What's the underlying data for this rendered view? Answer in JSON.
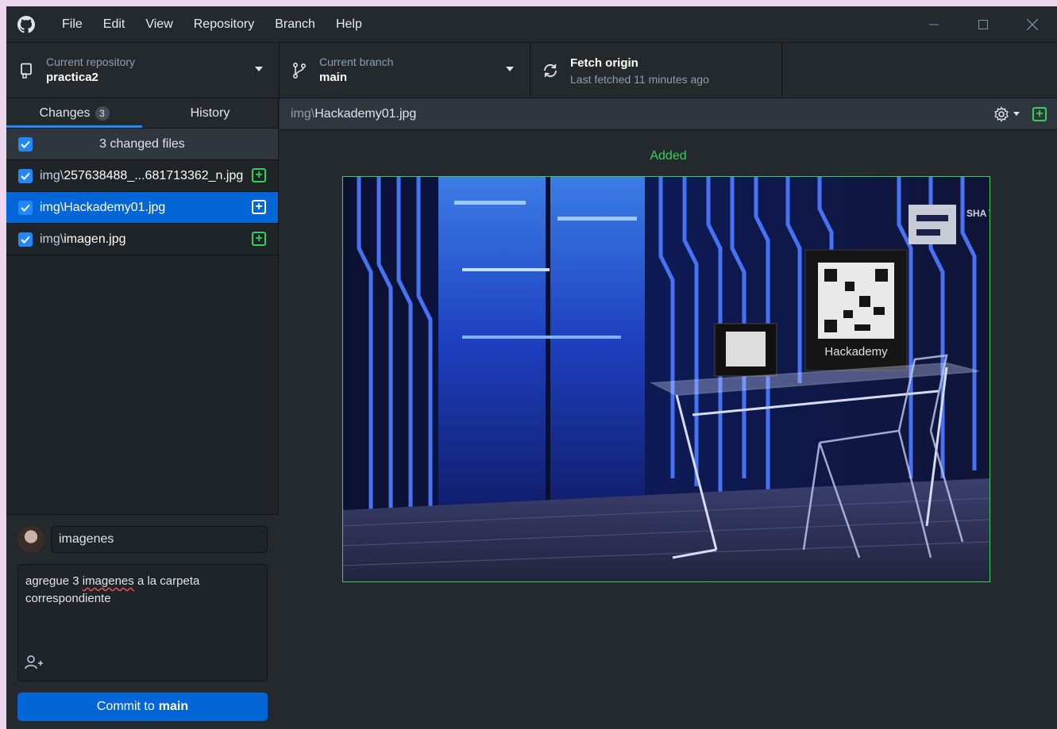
{
  "menu": {
    "items": [
      "File",
      "Edit",
      "View",
      "Repository",
      "Branch",
      "Help"
    ]
  },
  "toolbar": {
    "repo": {
      "sub": "Current repository",
      "main": "practica2"
    },
    "branch": {
      "sub": "Current branch",
      "main": "main"
    },
    "fetch": {
      "main": "Fetch origin",
      "sub": "Last fetched 11 minutes ago"
    }
  },
  "tabs": {
    "changes": {
      "label": "Changes",
      "badge": "3"
    },
    "history": {
      "label": "History"
    }
  },
  "files": {
    "header": "3 changed files",
    "items": [
      {
        "prefix": "img\\",
        "name": "257638488_...681713362_n.jpg",
        "selected": false
      },
      {
        "prefix": "img\\",
        "name": "Hackademy01.jpg",
        "selected": true
      },
      {
        "prefix": "img\\",
        "name": "imagen.jpg",
        "selected": false
      }
    ]
  },
  "commit": {
    "summary": "imagenes",
    "description_before": "agregue 3 ",
    "description_misspelled": "imagenes",
    "description_after": " a la carpeta correspondiente",
    "button_prefix": "Commit to",
    "button_branch": "main"
  },
  "diff": {
    "path_prefix": "img\\",
    "path_name": "Hackademy01.jpg",
    "status": "Added"
  },
  "image_text": {
    "screen_brand": "Hackademy",
    "corner_logo": "SHA TAN MEXI"
  },
  "colors": {
    "accent_blue": "#0366d6",
    "added_green": "#34d058",
    "background": "#24292e"
  }
}
